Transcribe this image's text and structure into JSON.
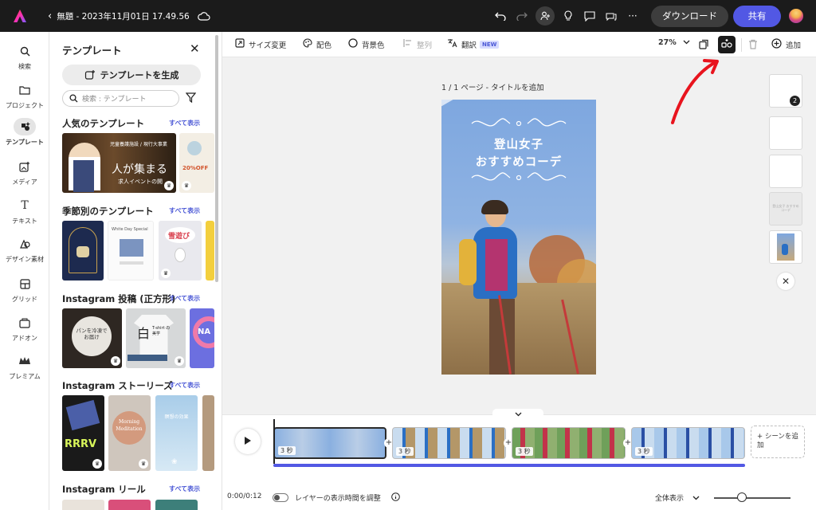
{
  "app": {
    "title": "無題 - 2023年11月01日 17.49.56",
    "download": "ダウンロード",
    "share": "共有"
  },
  "nav": [
    {
      "label": "検索",
      "icon": "search-icon"
    },
    {
      "label": "プロジェクト",
      "icon": "folder-icon"
    },
    {
      "label": "テンプレート",
      "icon": "template-icon"
    },
    {
      "label": "メディア",
      "icon": "media-icon"
    },
    {
      "label": "テキスト",
      "icon": "text-icon"
    },
    {
      "label": "デザイン素材",
      "icon": "shapes-icon"
    },
    {
      "label": "グリッド",
      "icon": "grid-icon"
    },
    {
      "label": "アドオン",
      "icon": "addon-icon"
    },
    {
      "label": "プレミアム",
      "icon": "crown-icon"
    }
  ],
  "panel": {
    "title": "テンプレート",
    "generate": "テンプレートを生成",
    "search_placeholder": "検索 : テンプレート",
    "sections": [
      {
        "title": "人気のテンプレート",
        "link": "すべて表示"
      },
      {
        "title": "季節別のテンプレート",
        "link": "すべて表示"
      },
      {
        "title": "Instagram 投稿 (正方形)",
        "link": "すべて表示"
      },
      {
        "title": "Instagram ストーリーズ",
        "link": "すべて表示"
      },
      {
        "title": "Instagram リール",
        "link": "すべて表示"
      }
    ],
    "thumb_texts": {
      "popular1": "人が集まる",
      "popular1_sub": "求人イベントの開",
      "popular1_tag": "児童養護施設 / 現行大事業",
      "popular2": "20%OFF",
      "seasonal2": "White Day  Special",
      "seasonal3": "雪遊び",
      "insta1": "パンを冷凍でお届け",
      "insta2": "白",
      "insta2_sub": "T-shirt の美学",
      "insta3": "NA",
      "story2_a": "Morning",
      "story2_b": "Meditation",
      "story3": "瞑想の効果",
      "story1": "RRRV"
    }
  },
  "toolbar": {
    "resize": "サイズ変更",
    "color": "配色",
    "bg": "背景色",
    "align": "整列",
    "translate": "翻訳",
    "new_badge": "NEW",
    "zoom": "27%",
    "add": "追加"
  },
  "canvas": {
    "page_label": "1 / 1 ページ - タイトルを追加",
    "title_line1": "登山女子",
    "title_line2": "おすすめコーデ",
    "side_badge": "2",
    "side_text": "登山女子 おすすめコーデ"
  },
  "timeline": {
    "clips": [
      {
        "dur": "3 秒"
      },
      {
        "dur": "3 秒"
      },
      {
        "dur": "3 秒"
      },
      {
        "dur": "3 秒"
      }
    ],
    "add_scene": "+ シーンを追加",
    "time": "0:00/0:12",
    "layer_label": "レイヤーの表示時間を調整",
    "fit": "全体表示"
  },
  "colors": {
    "accent": "#5258e4",
    "topbar": "#1b1b1b",
    "arrow": "#e8141e"
  }
}
